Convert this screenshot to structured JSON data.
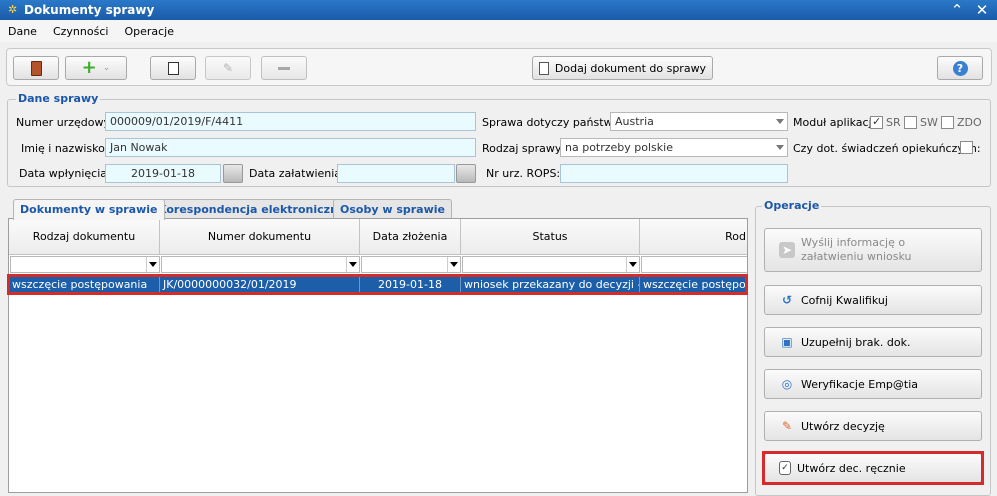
{
  "window": {
    "title": "Dokumenty sprawy"
  },
  "menu": [
    "Dane",
    "Czynności",
    "Operacje"
  ],
  "toolbar": {
    "add_doc_label": "Dodaj dokument do sprawy"
  },
  "case": {
    "legend": "Dane sprawy",
    "labels": {
      "office_number": "Numer urzędowy:",
      "name": "Imię i nazwisko:",
      "received_date": "Data wpłynięcia:",
      "settled_date": "Data załatwienia:",
      "country": "Sprawa dotyczy państwa:",
      "case_type": "Rodzaj sprawy:",
      "rops_number": "Nr urz. ROPS:",
      "module": "Moduł aplikacji:",
      "care_benefits": "Czy dot. świadczeń opiekuńczych:"
    },
    "values": {
      "office_number": "000009/01/2019/F/4411",
      "name": "Jan Nowak",
      "received_date": "2019-01-18",
      "settled_date": "",
      "country": "Austria",
      "case_type": "na potrzeby polskie",
      "rops_number": ""
    },
    "modules": [
      {
        "label": "SR",
        "checked": true
      },
      {
        "label": "SW",
        "checked": false
      },
      {
        "label": "ZDO",
        "checked": false
      }
    ]
  },
  "tabs": [
    "Dokumenty w sprawie",
    "Korespondencja elektroniczna",
    "Osoby w sprawie"
  ],
  "grid": {
    "columns": [
      "Rodzaj dokumentu",
      "Numer dokumentu",
      "Data złożenia",
      "Status",
      "Rod"
    ],
    "rows": [
      [
        "wszczęcie postępowania",
        "JK/0000000032/01/2019",
        "2019-01-18",
        "wniosek przekazany do decyzji - ...",
        "wszczęcie postępowa"
      ]
    ]
  },
  "operations": {
    "legend": "Operacje",
    "buttons": [
      "Wyślij informację o załatwieniu wniosku",
      "Cofnij Kwalifikuj",
      "Uzupełnij brak. dok.",
      "Weryfikacje Emp@tia",
      "Utwórz decyzję",
      "Utwórz dec. ręcznie"
    ]
  },
  "colors": {
    "accent": "#1c57a8",
    "highlight": "#d62b2b",
    "selected_row": "#1d5ea8"
  }
}
